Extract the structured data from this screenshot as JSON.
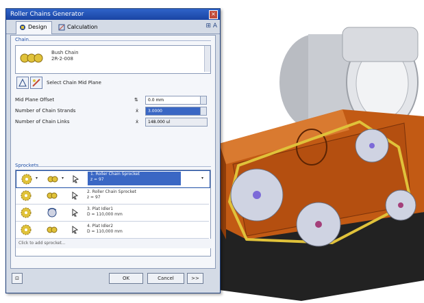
{
  "window": {
    "title": "Roller Chains Generator"
  },
  "tabs": [
    {
      "label": "Design"
    },
    {
      "label": "Calculation"
    }
  ],
  "chain": {
    "section_label": "Chain",
    "name_line1": "Bush Chain",
    "name_line2": "2R-2-008",
    "select_plane_label": "Select Chain Mid Plane"
  },
  "params": {
    "mid_plane_offset_label": "Mid Plane Offset",
    "mid_plane_offset_value": "0.0 mm",
    "strands_label": "Number of Chain Strands",
    "strands_value": "3.0000",
    "links_label": "Number of Chain Links",
    "links_value": "148.000 ul"
  },
  "sprockets": {
    "section_label": "Sprockets",
    "rows": [
      {
        "line1": "1. Roller Chain Sprocket",
        "line2": "z = 97"
      },
      {
        "line1": "2. Roller Chain Sprocket",
        "line2": "z = 97"
      },
      {
        "line1": "3. Plat Idler1",
        "line2": "D = 110,000 mm"
      },
      {
        "line1": "4. Plat Idler2",
        "line2": "D = 110,000 mm"
      }
    ],
    "add_label": "Click to add sprocket..."
  },
  "buttons": {
    "ok": "OK",
    "cancel": "Cancel",
    "more": ">>"
  },
  "colors": {
    "titlebar": "#2f64c9",
    "housing": "#c25a14",
    "chain": "#e0c23a",
    "selection": "#3a67c4"
  }
}
